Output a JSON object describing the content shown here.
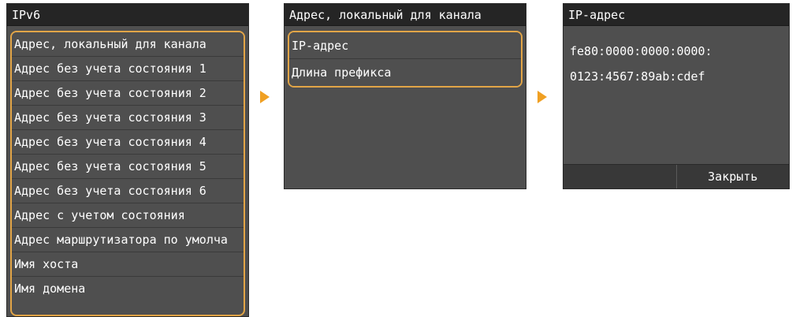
{
  "panel1": {
    "title": "IPv6",
    "items": [
      "Адрес, локальный для канала",
      "Адрес без учета состояния 1",
      "Адрес без учета состояния 2",
      "Адрес без учета состояния 3",
      "Адрес без учета состояния 4",
      "Адрес без учета состояния 5",
      "Адрес без учета состояния 6",
      "Адрес с учетом состояния",
      "Адрес маршрутизатора по умолча",
      "Имя хоста",
      "Имя домена"
    ]
  },
  "panel2": {
    "title": "Адрес, локальный для канала",
    "items": [
      "IP-адрес",
      "Длина префикса"
    ]
  },
  "panel3": {
    "title": "IP-адрес",
    "value_line1": "fe80:0000:0000:0000:",
    "value_line2": "0123:4567:89ab:cdef",
    "left_button": "",
    "close_button": "Закрыть"
  },
  "colors": {
    "highlight": "#e2a547",
    "arrow": "#f0a023",
    "panel_bg": "#4f4f4f",
    "title_bg": "#252525"
  },
  "icons": [
    "right-arrow-icon",
    "right-arrow-icon"
  ]
}
